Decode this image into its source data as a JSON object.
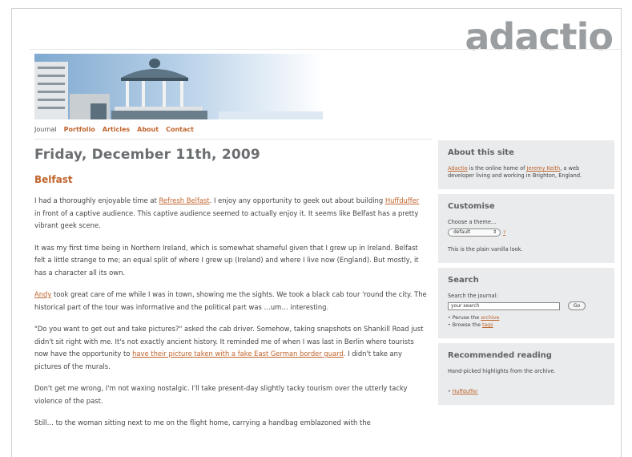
{
  "site": {
    "logo": "adactio"
  },
  "nav": {
    "items": [
      {
        "label": "Journal",
        "current": true
      },
      {
        "label": "Portfolio"
      },
      {
        "label": "Articles"
      },
      {
        "label": "About"
      },
      {
        "label": "Contact"
      }
    ]
  },
  "post": {
    "date": "Friday, December 11th, 2009",
    "title": "Belfast",
    "p1": {
      "a": "I had a thoroughly enjoyable time at ",
      "link1": "Refresh Belfast",
      "b": ". I enjoy any opportunity to geek out about building ",
      "link2": "Huffduffer",
      "c": " in front of a captive audience. This captive audience seemed to actually enjoy it. It seems like Belfast has a pretty vibrant geek scene."
    },
    "p2": "It was my first time being in Northern Ireland, which is somewhat shameful given that I grew up in Ireland. Belfast felt a little strange to me; an equal split of where I grew up (Ireland) and where I live now (England). But mostly, it has a character all its own.",
    "p3": {
      "link": "Andy",
      "text": " took great care of me while I was in town, showing me the sights. We took a black cab tour 'round the city. The historical part of the tour was informative and the political part was …um… interesting."
    },
    "p4": {
      "a": "\"Do you want to get out and take pictures?\" asked the cab driver. Somehow, taking snapshots on Shankill Road just didn't sit right with me. It's not exactly ancient history. It reminded me of when I was last in Berlin where tourists now have the opportunity to ",
      "link": "have their picture taken with a fake East German border guard",
      "b": ". I didn't take any pictures of the murals."
    },
    "p5": "Don't get me wrong, I'm not waxing nostalgic. I'll take present-day slightly tacky tourism over the utterly tacky violence of the past.",
    "p6": "Still… to the woman sitting next to me on the flight home, carrying a handbag emblazoned with the"
  },
  "sidebar": {
    "about": {
      "title": "About this site",
      "link1": "Adactio",
      "text1": " is the online home of ",
      "link2": "Jeremy Keith",
      "text2": ", a web developer living and working in Brighton, England."
    },
    "customise": {
      "title": "Customise",
      "label": "Choose a theme…",
      "selected": "default",
      "help": "?",
      "note": "This is the plain vanilla look."
    },
    "search": {
      "title": "Search",
      "label": "Search the journal:",
      "value": "your search",
      "button": "Go",
      "item1_a": "Peruse the ",
      "item1_link": "archive",
      "item2_a": "Browse the ",
      "item2_link": "tags"
    },
    "reading": {
      "title": "Recommended reading",
      "desc": "Hand-picked highlights from the archive.",
      "first_link": "Huffduffer"
    }
  },
  "colors": {
    "accent": "#c0642c",
    "panel": "#e9ebec",
    "logo": "#9a9ea1"
  }
}
